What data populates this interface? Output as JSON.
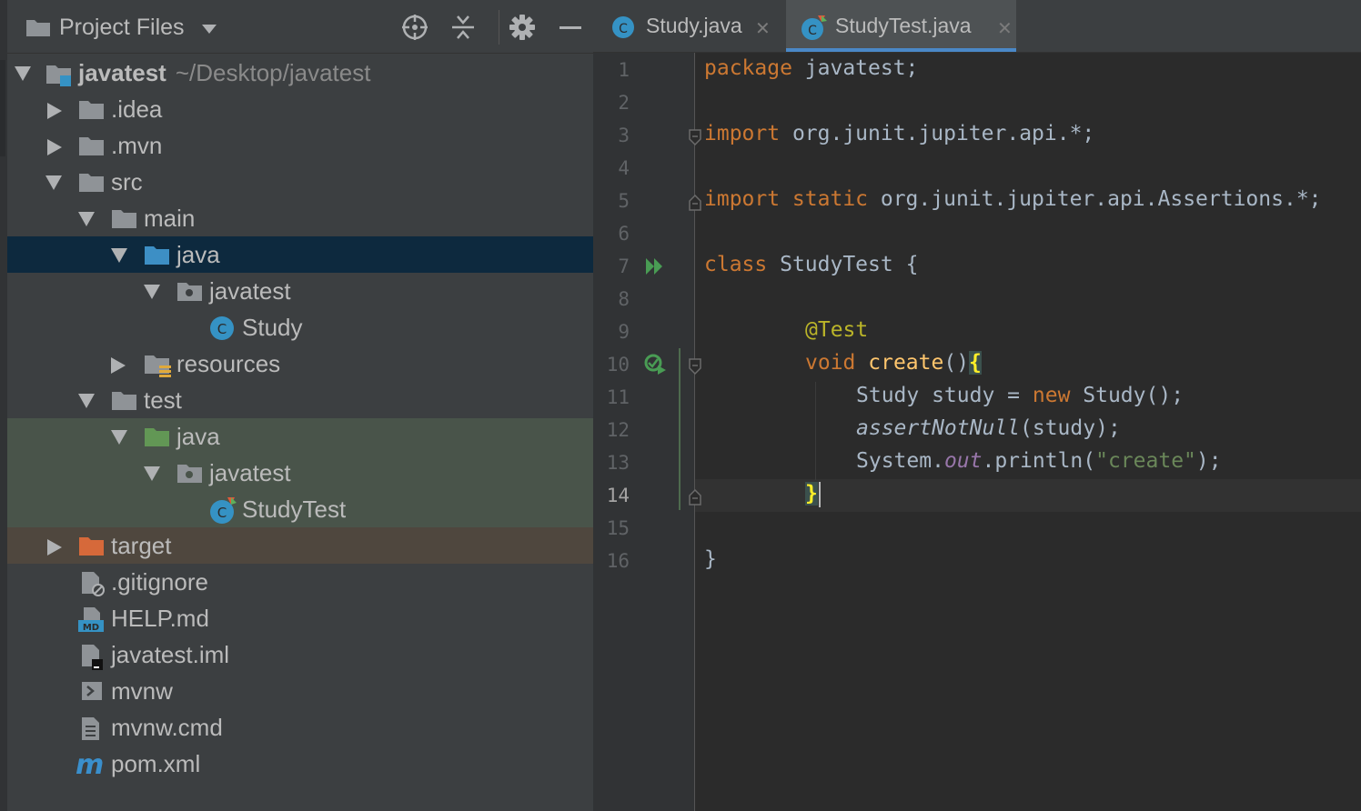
{
  "project_panel": {
    "title": "Project Files",
    "header_icons": [
      "locate-target-icon",
      "collapse-all-icon",
      "gear-icon",
      "minimize-icon"
    ],
    "tree": [
      {
        "label": "javatest",
        "path": "~/Desktop/javatest",
        "depth": 0,
        "expanded": true,
        "icon": "module-folder-icon"
      },
      {
        "label": ".idea",
        "depth": 1,
        "expanded": false,
        "icon": "folder-icon"
      },
      {
        "label": ".mvn",
        "depth": 1,
        "expanded": false,
        "icon": "folder-icon"
      },
      {
        "label": "src",
        "depth": 1,
        "expanded": true,
        "icon": "folder-icon"
      },
      {
        "label": "main",
        "depth": 2,
        "expanded": true,
        "icon": "folder-icon"
      },
      {
        "label": "java",
        "depth": 3,
        "expanded": true,
        "icon": "source-root-folder-icon",
        "selected": true
      },
      {
        "label": "javatest",
        "depth": 4,
        "expanded": true,
        "icon": "package-icon"
      },
      {
        "label": "Study",
        "depth": 5,
        "icon": "java-class-icon"
      },
      {
        "label": "resources",
        "depth": 3,
        "expanded": false,
        "icon": "resources-folder-icon"
      },
      {
        "label": "test",
        "depth": 2,
        "expanded": true,
        "icon": "folder-icon"
      },
      {
        "label": "java",
        "depth": 3,
        "expanded": true,
        "icon": "test-root-folder-icon"
      },
      {
        "label": "javatest",
        "depth": 4,
        "expanded": true,
        "icon": "package-icon"
      },
      {
        "label": "StudyTest",
        "depth": 5,
        "icon": "java-test-class-icon"
      },
      {
        "label": "target",
        "depth": 1,
        "expanded": false,
        "icon": "excluded-folder-icon"
      },
      {
        "label": ".gitignore",
        "depth": 1,
        "icon": "ignore-file-icon"
      },
      {
        "label": "HELP.md",
        "depth": 1,
        "icon": "markdown-file-icon"
      },
      {
        "label": "javatest.iml",
        "depth": 1,
        "icon": "iml-file-icon"
      },
      {
        "label": "mvnw",
        "depth": 1,
        "icon": "shell-script-icon"
      },
      {
        "label": "mvnw.cmd",
        "depth": 1,
        "icon": "text-file-icon"
      },
      {
        "label": "pom.xml",
        "depth": 1,
        "icon": "maven-icon"
      }
    ]
  },
  "editor": {
    "tabs": [
      {
        "label": "Study.java",
        "icon": "java-class-icon",
        "active": false
      },
      {
        "label": "StudyTest.java",
        "icon": "java-test-class-icon",
        "active": true
      }
    ],
    "current_line": 14,
    "lines": [
      {
        "n": "1"
      },
      {
        "n": "2"
      },
      {
        "n": "3"
      },
      {
        "n": "4"
      },
      {
        "n": "5"
      },
      {
        "n": "6"
      },
      {
        "n": "7"
      },
      {
        "n": "8"
      },
      {
        "n": "9"
      },
      {
        "n": "10"
      },
      {
        "n": "11"
      },
      {
        "n": "12"
      },
      {
        "n": "13"
      },
      {
        "n": "14"
      },
      {
        "n": "15"
      },
      {
        "n": "16"
      }
    ],
    "code": {
      "l1_kw": "package",
      "l1_rest": " javatest;",
      "l3_kw": "import",
      "l3_rest": " org.junit.jupiter.api.*;",
      "l5_kw": "import static",
      "l5_rest": " org.junit.jupiter.api.Assertions.*;",
      "l7_kw": "class",
      "l7_rest": " StudyTest {",
      "l9_ann": "@Test",
      "l10_kw": "void",
      "l10_fn": "create",
      "l10_paren": "()",
      "l10_brace": "{",
      "l11_a": "Study study = ",
      "l11_kw": "new",
      "l11_b": " Study();",
      "l12_it": "assertNotNull",
      "l12_rest": "(study);",
      "l13_a": "System.",
      "l13_field": "out",
      "l13_b": ".println(",
      "l13_str": "\"create\"",
      "l13_c": ");",
      "l14_brace": "}",
      "l16": "}"
    },
    "colors": {
      "keyword": "#cc7832",
      "annotation": "#bbb529",
      "method": "#ffc66d",
      "string": "#6a8759",
      "field": "#9876aa",
      "text": "#a9b7c6",
      "selection": "#0d293e",
      "test_root_bg": "#49544a",
      "excluded_bg": "#4f473e"
    }
  }
}
